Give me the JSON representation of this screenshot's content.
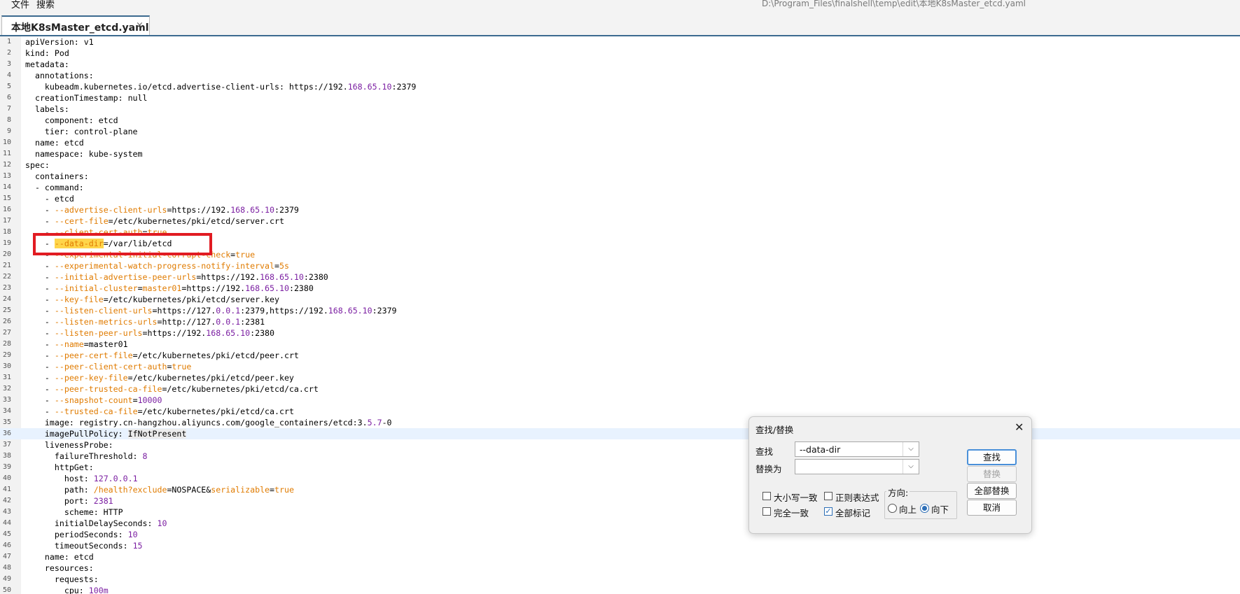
{
  "menu": {
    "file": "文件",
    "search": "搜索"
  },
  "window": {
    "path": "D:\\Program_Files\\finalshell\\temp\\edit\\本地K8sMaster_etcd.yaml"
  },
  "tab": {
    "label": "本地K8sMaster_etcd.yaml",
    "close": "×"
  },
  "editor": {
    "current_line": 36,
    "lines": [
      {
        "n": "1",
        "segs": [
          {
            "t": "apiVersion: v1"
          }
        ]
      },
      {
        "n": "2",
        "segs": [
          {
            "t": "kind: Pod"
          }
        ]
      },
      {
        "n": "3",
        "segs": [
          {
            "t": "metadata:"
          }
        ]
      },
      {
        "n": "4",
        "segs": [
          {
            "t": "  annotations:"
          }
        ]
      },
      {
        "n": "5",
        "segs": [
          {
            "t": "    kubeadm.kubernetes.io/etcd.advertise-client-urls: https://192."
          },
          {
            "t": "168.65.10",
            "c": "num"
          },
          {
            "t": ":2379"
          }
        ]
      },
      {
        "n": "6",
        "segs": [
          {
            "t": "  creationTimestamp: null"
          }
        ]
      },
      {
        "n": "7",
        "segs": [
          {
            "t": "  labels:"
          }
        ]
      },
      {
        "n": "8",
        "segs": [
          {
            "t": "    component: etcd"
          }
        ]
      },
      {
        "n": "9",
        "segs": [
          {
            "t": "    tier: control-plane"
          }
        ]
      },
      {
        "n": "10",
        "segs": [
          {
            "t": "  name: etcd"
          }
        ]
      },
      {
        "n": "11",
        "segs": [
          {
            "t": "  namespace: kube-system"
          }
        ]
      },
      {
        "n": "12",
        "segs": [
          {
            "t": "spec:"
          }
        ]
      },
      {
        "n": "13",
        "segs": [
          {
            "t": "  containers:"
          }
        ]
      },
      {
        "n": "14",
        "segs": [
          {
            "t": "  - command:"
          }
        ]
      },
      {
        "n": "15",
        "segs": [
          {
            "t": "    - etcd"
          }
        ]
      },
      {
        "n": "16",
        "segs": [
          {
            "t": "    - "
          },
          {
            "t": "--advertise-client-urls",
            "c": "flag"
          },
          {
            "t": "=https://192."
          },
          {
            "t": "168.65.10",
            "c": "num"
          },
          {
            "t": ":2379"
          }
        ]
      },
      {
        "n": "17",
        "segs": [
          {
            "t": "    - "
          },
          {
            "t": "--cert-file",
            "c": "flag"
          },
          {
            "t": "=/etc/kubernetes/pki/etcd/server.crt"
          }
        ]
      },
      {
        "n": "18",
        "segs": [
          {
            "t": "    - "
          },
          {
            "t": "--client-cert-auth",
            "c": "flag"
          },
          {
            "t": "="
          },
          {
            "t": "true",
            "c": "flag"
          }
        ]
      },
      {
        "n": "19",
        "segs": [
          {
            "t": "    - "
          },
          {
            "t": "--data-dir",
            "c": "flag hl"
          },
          {
            "t": "=/var/lib/etcd"
          }
        ]
      },
      {
        "n": "20",
        "segs": [
          {
            "t": "    - "
          },
          {
            "t": "--experimental-initial-corrupt-check",
            "c": "flag"
          },
          {
            "t": "="
          },
          {
            "t": "true",
            "c": "flag"
          }
        ]
      },
      {
        "n": "21",
        "segs": [
          {
            "t": "    - "
          },
          {
            "t": "--experimental-watch-progress-notify-interval",
            "c": "flag"
          },
          {
            "t": "="
          },
          {
            "t": "5s",
            "c": "flag"
          }
        ]
      },
      {
        "n": "22",
        "segs": [
          {
            "t": "    - "
          },
          {
            "t": "--initial-advertise-peer-urls",
            "c": "flag"
          },
          {
            "t": "=https://192."
          },
          {
            "t": "168.65.10",
            "c": "num"
          },
          {
            "t": ":2380"
          }
        ]
      },
      {
        "n": "23",
        "segs": [
          {
            "t": "    - "
          },
          {
            "t": "--initial-cluster",
            "c": "flag"
          },
          {
            "t": "="
          },
          {
            "t": "master01",
            "c": "flag"
          },
          {
            "t": "=https://192."
          },
          {
            "t": "168.65.10",
            "c": "num"
          },
          {
            "t": ":2380"
          }
        ]
      },
      {
        "n": "24",
        "segs": [
          {
            "t": "    - "
          },
          {
            "t": "--key-file",
            "c": "flag"
          },
          {
            "t": "=/etc/kubernetes/pki/etcd/server.key"
          }
        ]
      },
      {
        "n": "25",
        "segs": [
          {
            "t": "    - "
          },
          {
            "t": "--listen-client-urls",
            "c": "flag"
          },
          {
            "t": "=https://127."
          },
          {
            "t": "0.0.1",
            "c": "num"
          },
          {
            "t": ":2379,https://192."
          },
          {
            "t": "168.65.10",
            "c": "num"
          },
          {
            "t": ":2379"
          }
        ]
      },
      {
        "n": "26",
        "segs": [
          {
            "t": "    - "
          },
          {
            "t": "--listen-metrics-urls",
            "c": "flag"
          },
          {
            "t": "=http://127."
          },
          {
            "t": "0.0.1",
            "c": "num"
          },
          {
            "t": ":2381"
          }
        ]
      },
      {
        "n": "27",
        "segs": [
          {
            "t": "    - "
          },
          {
            "t": "--listen-peer-urls",
            "c": "flag"
          },
          {
            "t": "=https://192."
          },
          {
            "t": "168.65.10",
            "c": "num"
          },
          {
            "t": ":2380"
          }
        ]
      },
      {
        "n": "28",
        "segs": [
          {
            "t": "    - "
          },
          {
            "t": "--name",
            "c": "flag"
          },
          {
            "t": "=master01"
          }
        ]
      },
      {
        "n": "29",
        "segs": [
          {
            "t": "    - "
          },
          {
            "t": "--peer-cert-file",
            "c": "flag"
          },
          {
            "t": "=/etc/kubernetes/pki/etcd/peer.crt"
          }
        ]
      },
      {
        "n": "30",
        "segs": [
          {
            "t": "    - "
          },
          {
            "t": "--peer-client-cert-auth",
            "c": "flag"
          },
          {
            "t": "="
          },
          {
            "t": "true",
            "c": "flag"
          }
        ]
      },
      {
        "n": "31",
        "segs": [
          {
            "t": "    - "
          },
          {
            "t": "--peer-key-file",
            "c": "flag"
          },
          {
            "t": "=/etc/kubernetes/pki/etcd/peer.key"
          }
        ]
      },
      {
        "n": "32",
        "segs": [
          {
            "t": "    - "
          },
          {
            "t": "--peer-trusted-ca-file",
            "c": "flag"
          },
          {
            "t": "=/etc/kubernetes/pki/etcd/ca.crt"
          }
        ]
      },
      {
        "n": "33",
        "segs": [
          {
            "t": "    - "
          },
          {
            "t": "--snapshot-count",
            "c": "flag"
          },
          {
            "t": "="
          },
          {
            "t": "10000",
            "c": "num"
          }
        ]
      },
      {
        "n": "34",
        "segs": [
          {
            "t": "    - "
          },
          {
            "t": "--trusted-ca-file",
            "c": "flag"
          },
          {
            "t": "=/etc/kubernetes/pki/etcd/ca.crt"
          }
        ]
      },
      {
        "n": "35",
        "segs": [
          {
            "t": "    image: registry.cn-hangzhou.aliyuncs.com/google_containers/etcd:3."
          },
          {
            "t": "5.7",
            "c": "num"
          },
          {
            "t": "-0"
          }
        ]
      },
      {
        "n": "36",
        "segs": [
          {
            "t": "    imagePullPolicy: "
          },
          {
            "t": "IfNotPresent",
            "c": "plainhl"
          }
        ]
      },
      {
        "n": "37",
        "segs": [
          {
            "t": "    livenessProbe:"
          }
        ]
      },
      {
        "n": "38",
        "segs": [
          {
            "t": "      failureThreshold: "
          },
          {
            "t": "8",
            "c": "num"
          }
        ]
      },
      {
        "n": "39",
        "segs": [
          {
            "t": "      httpGet:"
          }
        ]
      },
      {
        "n": "40",
        "segs": [
          {
            "t": "        host: "
          },
          {
            "t": "127.0.0.1",
            "c": "num"
          }
        ]
      },
      {
        "n": "41",
        "segs": [
          {
            "t": "        path: "
          },
          {
            "t": "/health?exclude",
            "c": "flag"
          },
          {
            "t": "=NOSPACE&"
          },
          {
            "t": "serializable",
            "c": "flag"
          },
          {
            "t": "="
          },
          {
            "t": "true",
            "c": "flag"
          }
        ]
      },
      {
        "n": "42",
        "segs": [
          {
            "t": "        port: "
          },
          {
            "t": "2381",
            "c": "num"
          }
        ]
      },
      {
        "n": "43",
        "segs": [
          {
            "t": "        scheme: HTTP"
          }
        ]
      },
      {
        "n": "44",
        "segs": [
          {
            "t": "      initialDelaySeconds: "
          },
          {
            "t": "10",
            "c": "num"
          }
        ]
      },
      {
        "n": "45",
        "segs": [
          {
            "t": "      periodSeconds: "
          },
          {
            "t": "10",
            "c": "num"
          }
        ]
      },
      {
        "n": "46",
        "segs": [
          {
            "t": "      timeoutSeconds: "
          },
          {
            "t": "15",
            "c": "num"
          }
        ]
      },
      {
        "n": "47",
        "segs": [
          {
            "t": "    name: etcd"
          }
        ]
      },
      {
        "n": "48",
        "segs": [
          {
            "t": "    resources:"
          }
        ]
      },
      {
        "n": "49",
        "segs": [
          {
            "t": "      requests:"
          }
        ]
      },
      {
        "n": "50",
        "segs": [
          {
            "t": "        cpu: "
          },
          {
            "t": "100m",
            "c": "num"
          }
        ]
      }
    ]
  },
  "dialog": {
    "title": "查找/替换",
    "close": "✕",
    "find_label": "查找",
    "find_value": "--data-dir",
    "replace_label": "替换为",
    "replace_value": "",
    "btn_find": "查找",
    "btn_replace": "替换",
    "btn_replace_all": "全部替换",
    "btn_cancel": "取消",
    "opt_match_case": {
      "label": "大小写一致",
      "checked": false
    },
    "opt_regex": {
      "label": "正则表达式",
      "checked": false
    },
    "opt_whole_word": {
      "label": "完全一致",
      "checked": false
    },
    "opt_mark_all": {
      "label": "全部标记",
      "checked": true
    },
    "direction": {
      "label": "方向:",
      "up": "向上",
      "down": "向下",
      "selected": "down"
    }
  },
  "colors": {
    "accent": "#3c6a8f",
    "flag": "#e07b00",
    "number": "#7b1fa2",
    "match_highlight": "#ffd54a",
    "annotation_box": "#e11b22"
  }
}
